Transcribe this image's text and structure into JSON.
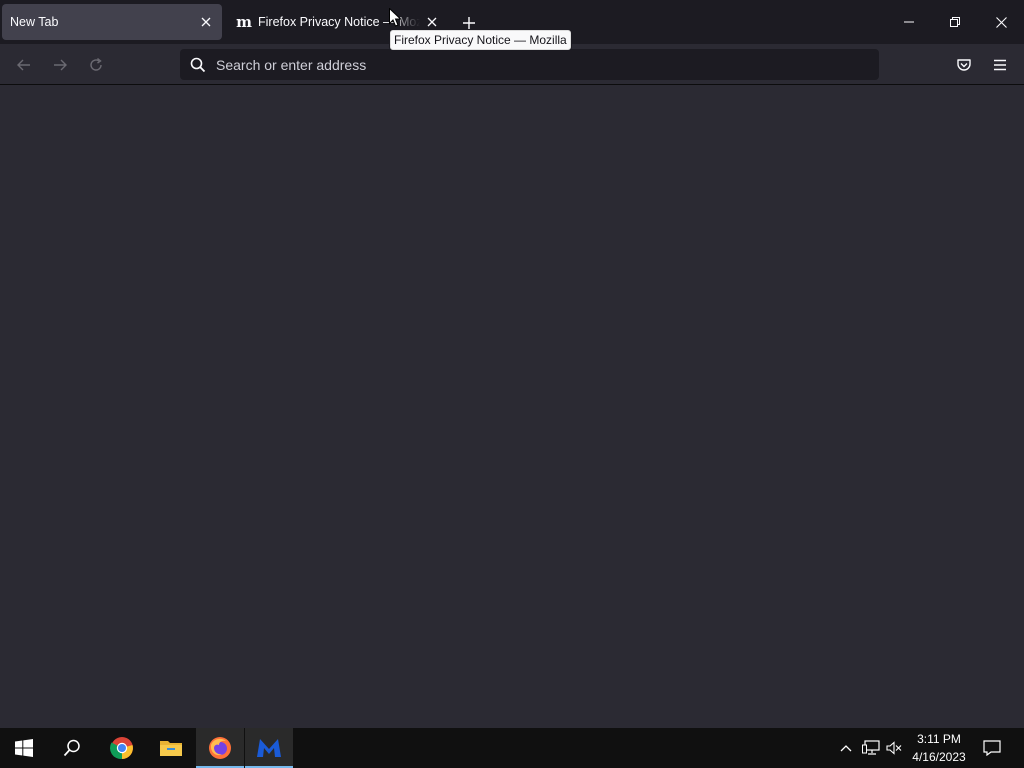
{
  "browser": {
    "tabs": [
      {
        "label": "New Tab",
        "active": true
      },
      {
        "label": "Firefox Privacy Notice — Mozilla",
        "active": false,
        "favicon": "mozilla-m-icon"
      }
    ],
    "tooltip": "Firefox Privacy Notice — Mozilla",
    "urlbar": {
      "placeholder": "Search or enter address",
      "value": ""
    },
    "toolbar_icons": [
      "back-arrow-icon",
      "forward-arrow-icon",
      "reload-icon",
      "pocket-icon",
      "hamburger-menu-icon"
    ],
    "window_controls": [
      "minimize-icon",
      "restore-icon",
      "close-icon"
    ]
  },
  "taskbar": {
    "apps": [
      "windows-start-icon",
      "search-icon",
      "chrome-icon",
      "file-explorer-icon",
      "firefox-icon",
      "malwarebytes-icon"
    ],
    "active_apps": [
      "firefox-icon",
      "malwarebytes-icon"
    ],
    "tray_icons": [
      "chevron-up-icon",
      "network-icon",
      "volume-muted-icon",
      "notifications-icon"
    ],
    "time": "3:11 PM",
    "date": "4/16/2023"
  },
  "colors": {
    "tabstrip_bg": "#1c1b22",
    "toolbar_bg": "#2b2a33",
    "active_tab_bg": "#42414d",
    "taskbar_bg": "#101010",
    "taskbar_active_indicator": "#76b9ed"
  }
}
